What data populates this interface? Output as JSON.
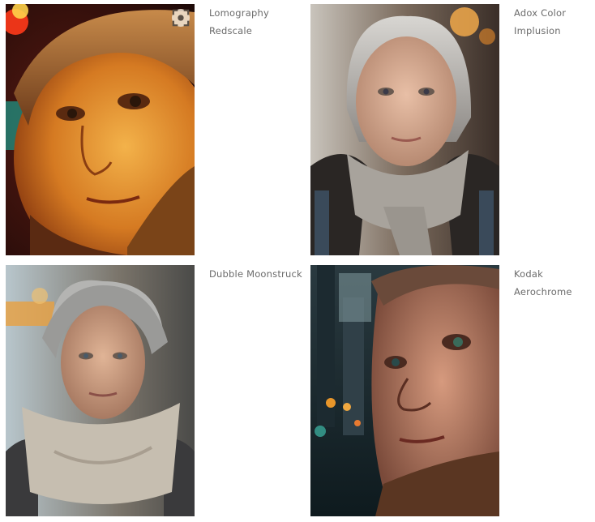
{
  "gallery": {
    "items": [
      {
        "caption_lines": [
          "Lomography",
          "Redscale"
        ],
        "image_alt": "Close-up portrait of an older woman in a fur hat with warm orange-red tones",
        "accent": "#d98a24"
      },
      {
        "caption_lines": [
          "Adox Color",
          "Implusion"
        ],
        "image_alt": "Portrait of a gray-haired woman with a gray scarf on a city street",
        "accent": "#8a8a88"
      },
      {
        "caption_lines": [
          "Dubble Moonstruck"
        ],
        "image_alt": "Portrait of a woman with short tousled gray hair and a beige scarf",
        "accent": "#a8a093"
      },
      {
        "caption_lines": [
          "Kodak Aerochrome"
        ],
        "image_alt": "Close-up portrait of an older woman with city lights behind her",
        "accent": "#b0715c"
      }
    ],
    "lens_icon": "visual-search-icon"
  }
}
